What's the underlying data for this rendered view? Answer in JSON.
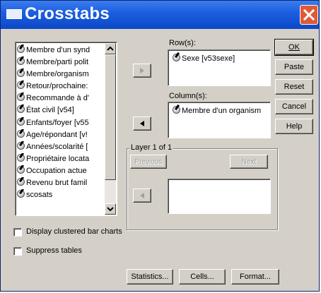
{
  "window": {
    "title": "Crosstabs"
  },
  "variables": {
    "items": [
      "Membre d'un synd",
      "Membre/parti polit",
      "Membre/organism",
      "Retour/prochaine:",
      "Recommande à d'",
      "État civil [v54]",
      "Enfants/foyer [v55",
      "Age/répondant [v!",
      "Années/scolarité [",
      "Propriétaire locata",
      "Occupation actue",
      "Revenu brut famil",
      "scosats"
    ]
  },
  "rows": {
    "label": "Row(s):",
    "items": [
      "Sexe [v53sexe]"
    ]
  },
  "columns": {
    "label": "Column(s):",
    "items": [
      "Membre d'un organism"
    ]
  },
  "layer": {
    "label": "Layer 1 of 1",
    "previous": "Previous",
    "next": "Next"
  },
  "buttons": {
    "ok": "OK",
    "paste": "Paste",
    "reset": "Reset",
    "cancel": "Cancel",
    "help": "Help"
  },
  "options": {
    "clustered": {
      "label": "Display clustered bar charts",
      "checked": false
    },
    "suppress": {
      "label": "Suppress tables",
      "checked": false
    }
  },
  "bottom_buttons": {
    "statistics": "Statistics...",
    "cells": "Cells...",
    "format": "Format..."
  }
}
